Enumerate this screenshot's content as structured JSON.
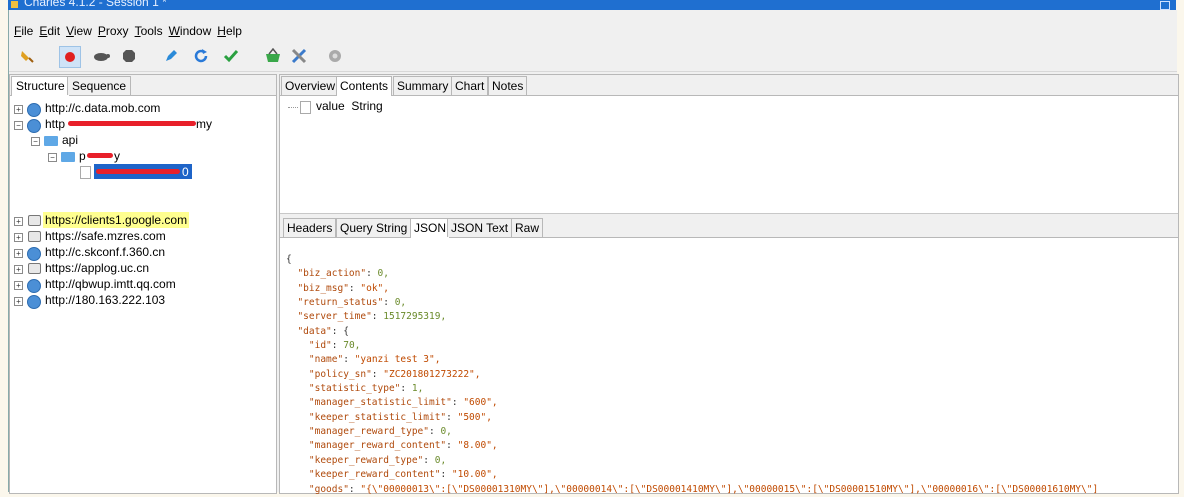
{
  "window": {
    "title": "Charles 4.1.2 - Session 1 *"
  },
  "menu": [
    "File",
    "Edit",
    "View",
    "Proxy",
    "Tools",
    "Window",
    "Help"
  ],
  "toolbar_icons": [
    "broom-icon",
    "record-icon",
    "turtle-icon",
    "stop-icon",
    "pen-icon",
    "refresh-icon",
    "check-icon",
    "basket-icon",
    "tools-icon",
    "settings-icon"
  ],
  "left": {
    "tabs": [
      "Structure",
      "Sequence"
    ],
    "hosts": [
      {
        "label": "http://c.data.mob.com",
        "icon": "globe-icon"
      },
      {
        "label": "http",
        "suffix": "my",
        "icon": "globe-icon"
      },
      {
        "label": "api",
        "icon": "folder-icon"
      },
      {
        "label": "p",
        "suffix": "y",
        "icon": "folder-icon"
      },
      {
        "label": "0",
        "icon": "doc-icon"
      },
      {
        "label": "https://clients1.google.com",
        "icon": "lock-icon"
      },
      {
        "label": "https://safe.mzres.com",
        "icon": "lock-icon"
      },
      {
        "label": "http://c.skconf.f.360.cn",
        "icon": "globe-icon"
      },
      {
        "label": "https://applog.uc.cn",
        "icon": "lock-icon"
      },
      {
        "label": "http://qbwup.imtt.qq.com",
        "icon": "globe-icon"
      },
      {
        "label": "http://180.163.222.103",
        "icon": "globe-icon"
      }
    ]
  },
  "right": {
    "top_tabs": [
      "Overview",
      "Contents",
      "Summary",
      "Chart",
      "Notes"
    ],
    "active_top_tab": "Contents",
    "content_node": {
      "name": "value",
      "type": "String"
    },
    "bottom_tabs": [
      "Headers",
      "Query String",
      "JSON",
      "JSON Text",
      "Raw"
    ],
    "active_bottom_tab": "JSON",
    "json_lines": [
      {
        "i": 0,
        "t": "{"
      },
      {
        "i": 1,
        "k": "\"biz_action\"",
        "v": "0,"
      },
      {
        "i": 1,
        "k": "\"biz_msg\"",
        "v": "\"ok\","
      },
      {
        "i": 1,
        "k": "\"return_status\"",
        "v": "0,"
      },
      {
        "i": 1,
        "k": "\"server_time\"",
        "v": "1517295319,"
      },
      {
        "i": 1,
        "k": "\"data\"",
        "v": "{"
      },
      {
        "i": 2,
        "k": "\"id\"",
        "v": "70,"
      },
      {
        "i": 2,
        "k": "\"name\"",
        "v": "\"yanzi test 3\","
      },
      {
        "i": 2,
        "k": "\"policy_sn\"",
        "v": "\"ZC201801273222\","
      },
      {
        "i": 2,
        "k": "\"statistic_type\"",
        "v": "1,"
      },
      {
        "i": 2,
        "k": "\"manager_statistic_limit\"",
        "v": "\"600\","
      },
      {
        "i": 2,
        "k": "\"keeper_statistic_limit\"",
        "v": "\"500\","
      },
      {
        "i": 2,
        "k": "\"manager_reward_type\"",
        "v": "0,"
      },
      {
        "i": 2,
        "k": "\"manager_reward_content\"",
        "v": "\"8.00\","
      },
      {
        "i": 2,
        "k": "\"keeper_reward_type\"",
        "v": "0,"
      },
      {
        "i": 2,
        "k": "\"keeper_reward_content\"",
        "v": "\"10.00\","
      },
      {
        "i": 2,
        "k": "\"goods\"",
        "v": "\"{\\\"00000013\\\":[\\\"DS00001310MY\\\"],\\\"00000014\\\":[\\\"DS00001410MY\\\"],\\\"00000015\\\":[\\\"DS00001510MY\\\"],\\\"00000016\\\":[\\\"DS00001610MY\\\"]"
      }
    ]
  }
}
